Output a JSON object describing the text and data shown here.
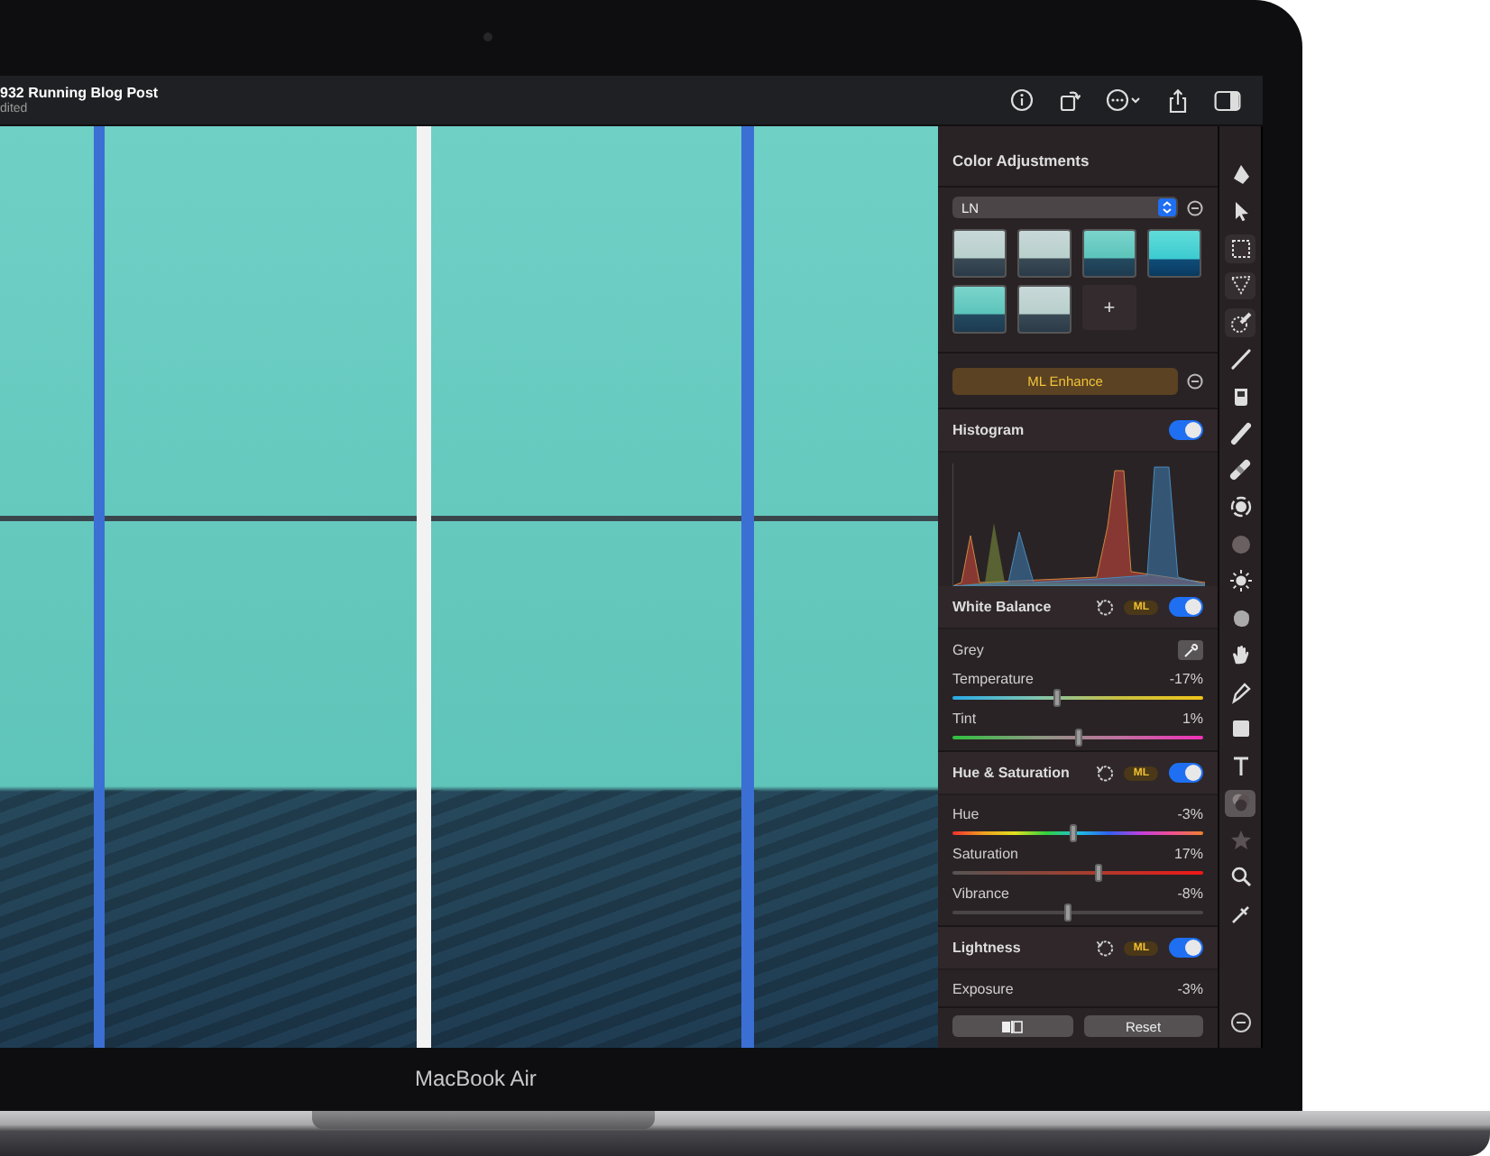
{
  "window": {
    "title": "932 Running Blog Post",
    "subtitle": "dited"
  },
  "panel": {
    "title": "Color Adjustments",
    "preset": {
      "value": "LN"
    },
    "presets": [
      {
        "kind": "faded"
      },
      {
        "kind": "faded"
      },
      {
        "kind": "teal"
      },
      {
        "kind": "vivid"
      },
      {
        "kind": "teal"
      },
      {
        "kind": "faded"
      }
    ],
    "add_label": "+",
    "ml_enhance": "ML Enhance",
    "sections": [
      {
        "kind": "histogram",
        "title": "Histogram",
        "on": true
      },
      {
        "kind": "adjustment",
        "title": "White Balance",
        "ml_badge": "ML",
        "on": true,
        "rows": [
          {
            "kind": "picker",
            "label": "Grey"
          },
          {
            "kind": "temperature",
            "label": "Temperature",
            "reading": "-17%",
            "level": 0.42
          },
          {
            "kind": "tint",
            "label": "Tint",
            "reading": "1%",
            "level": 0.505
          }
        ]
      },
      {
        "kind": "adjustment",
        "title": "Hue & Saturation",
        "ml_badge": "ML",
        "on": true,
        "rows": [
          {
            "kind": "hue",
            "label": "Hue",
            "reading": "-3%",
            "level": 0.485
          },
          {
            "kind": "saturation",
            "label": "Saturation",
            "reading": "17%",
            "level": 0.585
          },
          {
            "kind": "neutral",
            "label": "Vibrance",
            "reading": "-8%",
            "level": 0.46
          }
        ]
      },
      {
        "kind": "adjustment",
        "title": "Lightness",
        "ml_badge": "ML",
        "on": true,
        "rows": [
          {
            "kind": "reading",
            "label": "Exposure",
            "reading": "-3%"
          }
        ]
      }
    ],
    "reset": "Reset"
  },
  "toolbar": [
    {
      "selected": false,
      "framed": false
    },
    {
      "selected": false,
      "framed": false
    },
    {
      "selected": false,
      "framed": true
    },
    {
      "selected": false,
      "framed": true
    },
    {
      "selected": false,
      "framed": true
    },
    {
      "selected": false,
      "framed": false
    },
    {
      "selected": false,
      "framed": false
    },
    {
      "selected": false,
      "framed": false
    },
    {
      "selected": false,
      "framed": false
    },
    {
      "selected": false,
      "framed": false
    },
    {
      "selected": false,
      "framed": false
    },
    {
      "selected": false,
      "framed": false
    },
    {
      "selected": false,
      "framed": false
    },
    {
      "selected": false,
      "framed": false
    },
    {
      "selected": false,
      "framed": false
    },
    {
      "selected": false,
      "framed": false
    },
    {
      "selected": false,
      "framed": false
    },
    {
      "selected": true,
      "framed": false
    },
    {
      "selected": false,
      "framed": false
    },
    {
      "selected": false,
      "framed": false
    },
    {
      "selected": false,
      "framed": false
    },
    {
      "selected": false,
      "framed": false
    }
  ],
  "device": {
    "label": "MacBook Air"
  }
}
